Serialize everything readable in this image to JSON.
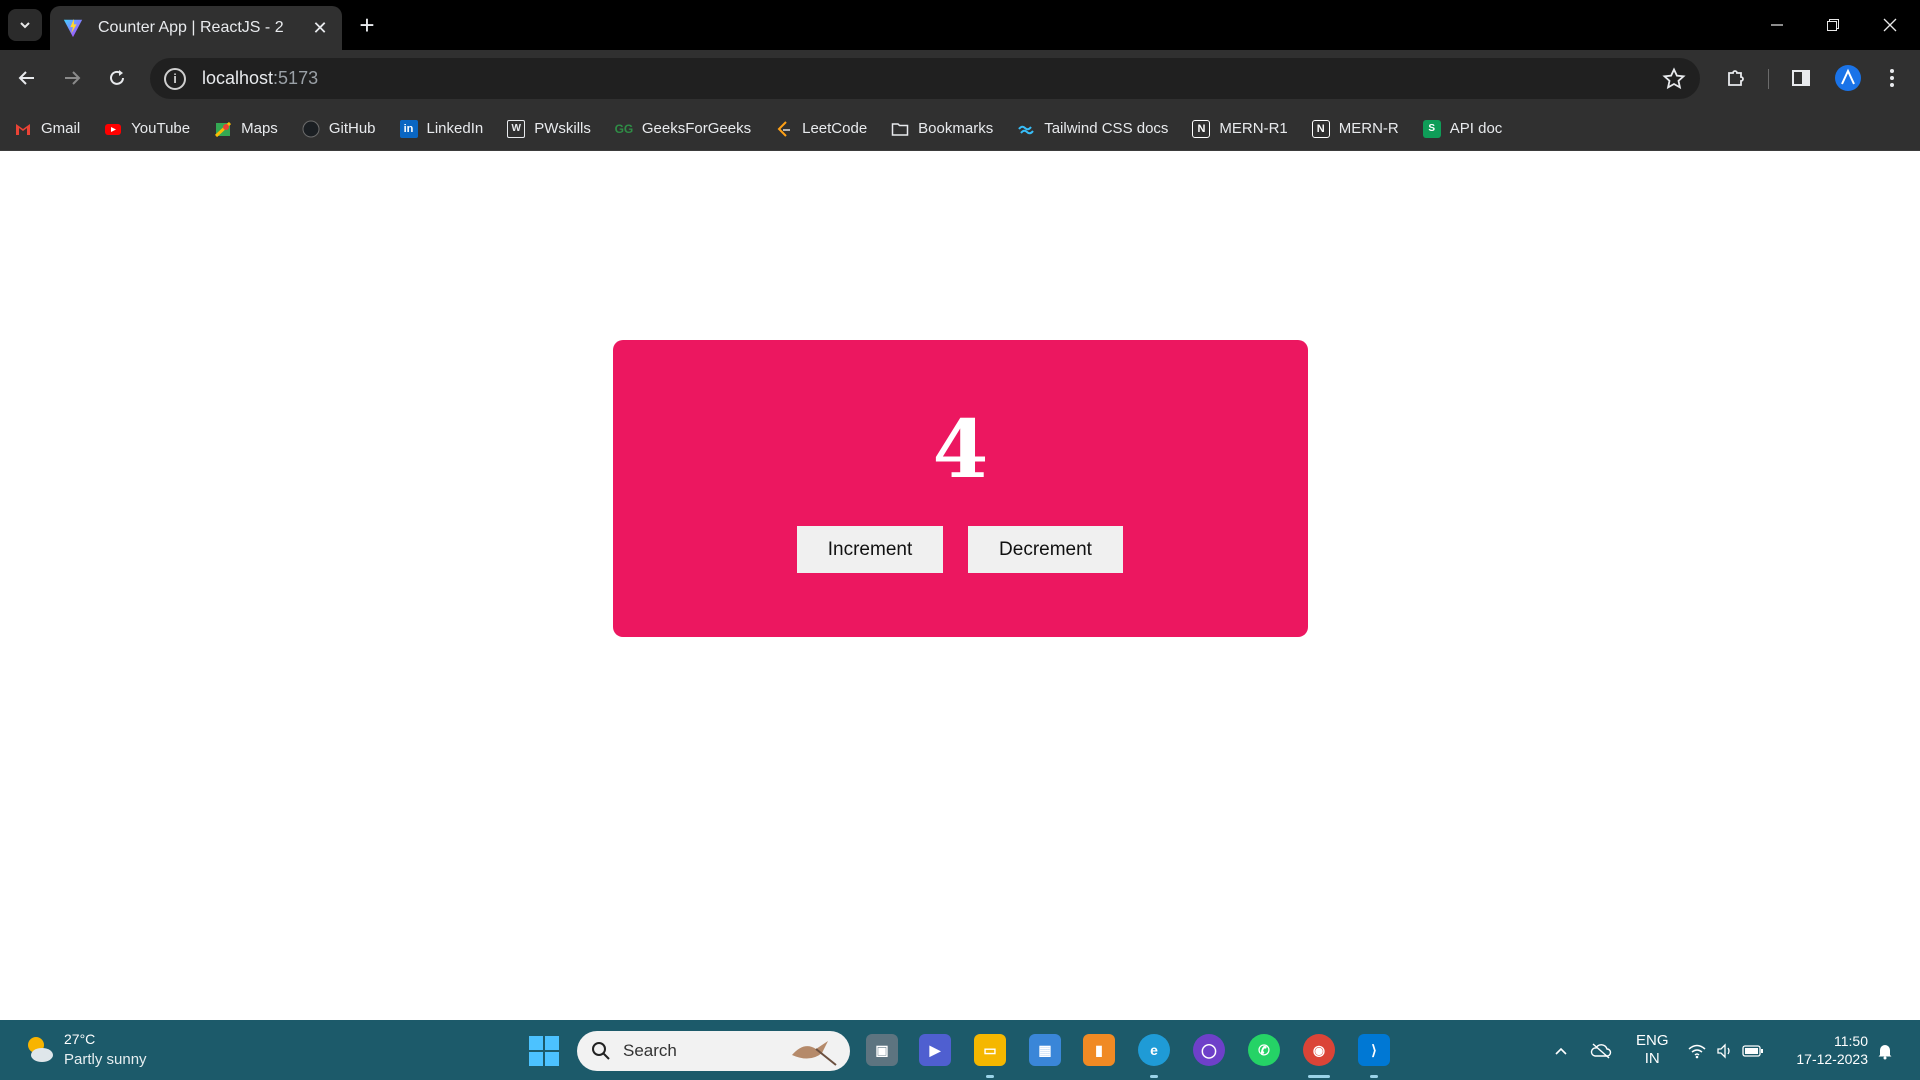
{
  "browser": {
    "tab": {
      "title": "Counter App | ReactJS - 2",
      "close": "✕"
    },
    "new_tab": "+",
    "address": {
      "host": "localhost",
      "port": ":5173"
    }
  },
  "bookmarks": [
    {
      "label": "Gmail",
      "icon": "gmail-icon",
      "color": "#ea4335"
    },
    {
      "label": "YouTube",
      "icon": "youtube-icon",
      "color": "#ff0000"
    },
    {
      "label": "Maps",
      "icon": "maps-icon",
      "color": "#34a853"
    },
    {
      "label": "GitHub",
      "icon": "github-icon",
      "color": "#1b1f23"
    },
    {
      "label": "LinkedIn",
      "icon": "linkedin-icon",
      "color": "#0a66c2"
    },
    {
      "label": "PWskills",
      "icon": "pwskills-icon",
      "color": "#ffffff"
    },
    {
      "label": "GeeksForGeeks",
      "icon": "geeksforgeeks-icon",
      "color": "#2f8d46"
    },
    {
      "label": "LeetCode",
      "icon": "leetcode-icon",
      "color": "#ffa116"
    },
    {
      "label": "Bookmarks",
      "icon": "folder-icon",
      "color": "#e8eaed"
    },
    {
      "label": "Tailwind CSS docs",
      "icon": "tailwind-icon",
      "color": "#38bdf8"
    },
    {
      "label": "MERN-R1",
      "icon": "notion-icon",
      "color": "#ffffff"
    },
    {
      "label": "MERN-R",
      "icon": "notion-icon",
      "color": "#ffffff"
    },
    {
      "label": "API doc",
      "icon": "api-doc-icon",
      "color": "#0f9d58"
    }
  ],
  "app": {
    "count": "4",
    "increment_label": "Increment",
    "decrement_label": "Decrement",
    "card_color": "#ec1760"
  },
  "taskbar": {
    "weather": {
      "temp": "27°C",
      "desc": "Partly sunny"
    },
    "search_label": "Search",
    "lang": {
      "line1": "ENG",
      "line2": "IN"
    },
    "clock": {
      "time": "11:50",
      "date": "17-12-2023"
    }
  }
}
